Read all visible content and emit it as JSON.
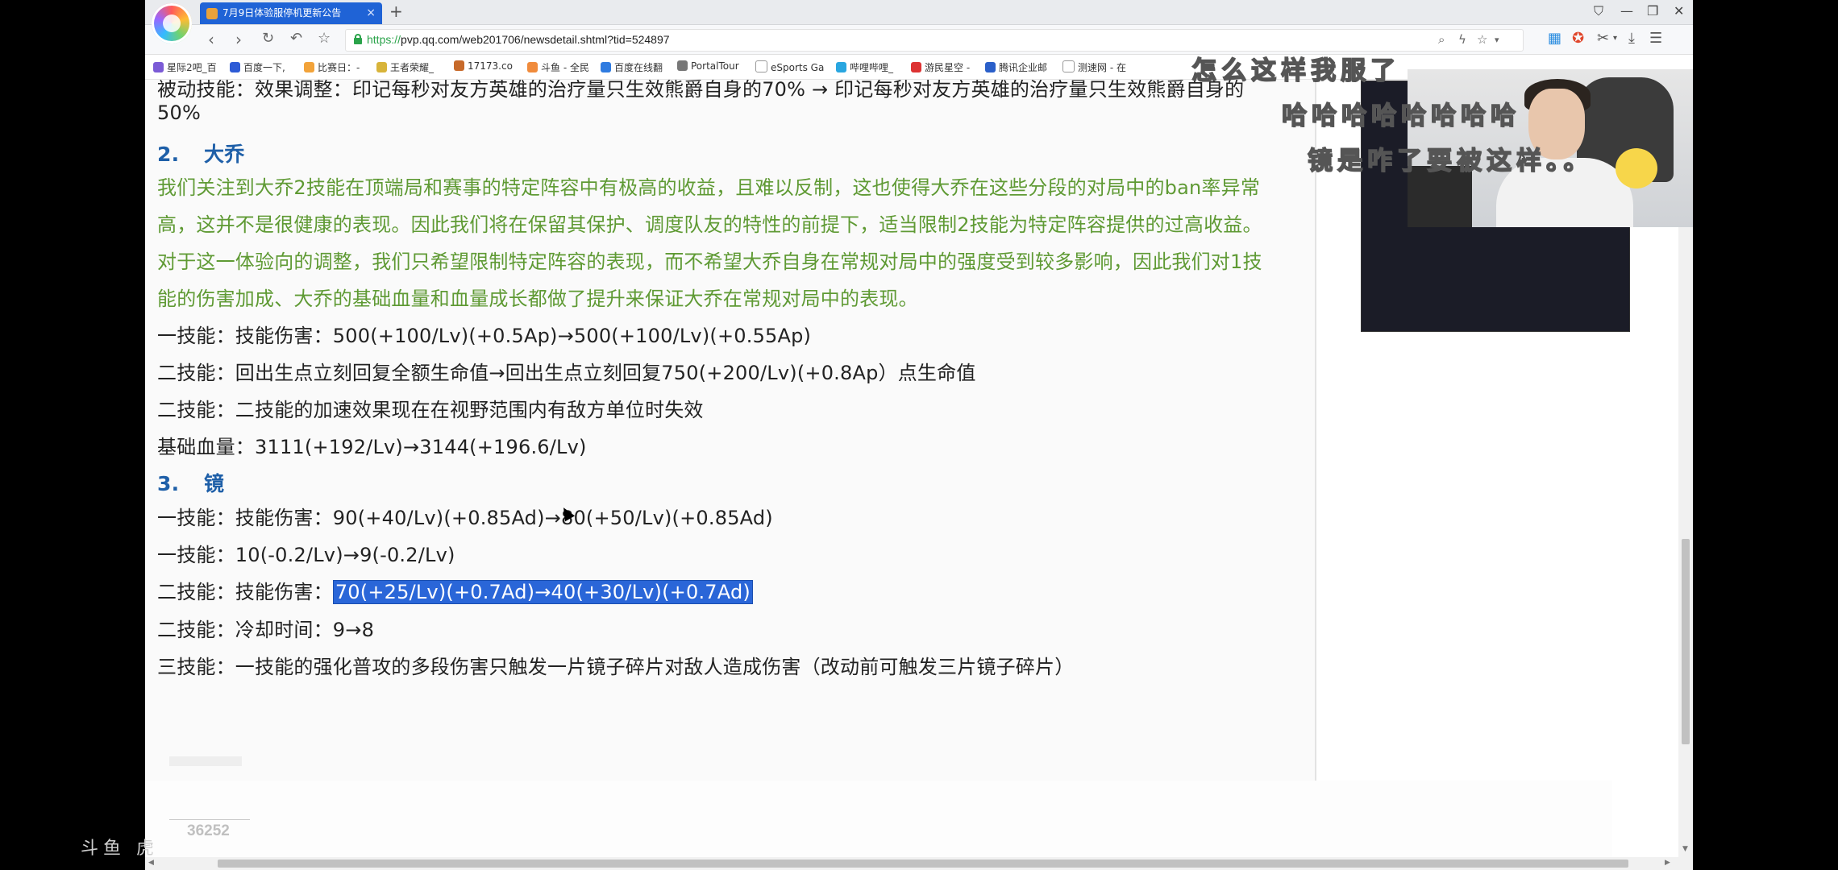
{
  "browser": {
    "tab_title": "7月9日体验服停机更新公告",
    "tab_close": "×",
    "new_tab": "+",
    "url_scheme": "https://",
    "url_rest": "pvp.qq.com/web201706/newsdetail.shtml?tid=524897",
    "bookmarks": [
      "星际2吧_百",
      "百度一下,",
      "比赛日：-",
      "王者荣耀_",
      "17173.co",
      "斗鱼 - 全民",
      "百度在线翻",
      "PortalTour",
      "eSports Ga",
      "哔哩哔哩_",
      "游民星空 -",
      "腾讯企业邮",
      "测速网 - 在"
    ]
  },
  "article": {
    "lines": [
      "被动技能：效果调整：印记每秒对友方英雄的治疗量只生效熊爵自身的70% → 印记每秒对友方英雄的治疗量只生效熊爵自身的",
      "50%"
    ],
    "sections": [
      {
        "number": "2.",
        "hero": "大乔",
        "intro": [
          "我们关注到大乔2技能在顶端局和赛事的特定阵容中有极高的收益，且难以反制，这也使得大乔在这些分段的对局中的ban率异常",
          "高，这并不是很健康的表现。因此我们将在保留其保护、调度队友的特性的前提下，适当限制2技能为特定阵容提供的过高收益。",
          "对于这一体验向的调整，我们只希望限制特定阵容的表现，而不希望大乔自身在常规对局中的强度受到较多影响，因此我们对1技",
          "能的伤害加成、大乔的基础血量和血量成长都做了提升来保证大乔在常规对局中的表现。"
        ],
        "changes": [
          "一技能：技能伤害：500(+100/Lv)(+0.5Ap)→500(+100/Lv)(+0.55Ap)",
          "二技能：回出生点立刻回复全额生命值→回出生点立刻回复750(+200/Lv)(+0.8Ap）点生命值",
          "二技能：二技能的加速效果现在在视野范围内有敌方单位时失效",
          "基础血量：3111(+192/Lv)→3144(+196.6/Lv)"
        ]
      },
      {
        "number": "3.",
        "hero": "镜",
        "changes": [
          "一技能：技能伤害：90(+40/Lv)(+0.85Ad)→80(+50/Lv)(+0.85Ad)",
          "一技能：10(-0.2/Lv)→9(-0.2/Lv)"
        ],
        "highlight_prefix": "二技能：技能伤害：",
        "highlight_text": "70(+25/Lv)(+0.7Ad)→40(+30/Lv)(+0.7Ad)",
        "changes_after": [
          "二技能：冷却时间：9→8",
          "三技能：一技能的强化普攻的多段伤害只触发一片镜子碎片对敌人造成伤害（改动前可触发三片镜子碎片）"
        ]
      }
    ],
    "footer_count": "36252"
  },
  "overlay": {
    "danmaku": [
      "怎么这样我服了",
      "哈哈哈哈哈哈哈哈",
      "镜是咋了要被这样。。"
    ],
    "watermark": "斗鱼 虎"
  }
}
